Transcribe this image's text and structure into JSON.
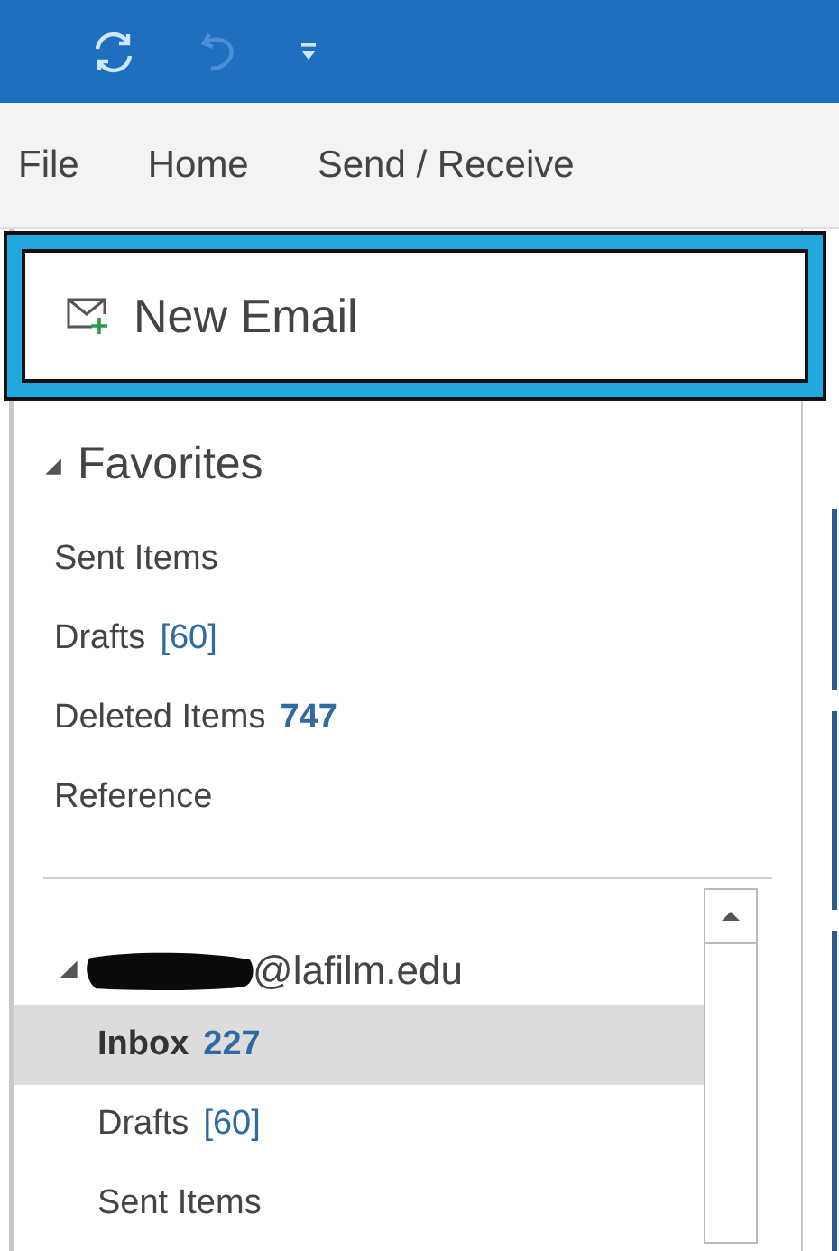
{
  "menu": [
    {
      "label": "File",
      "selected": false
    },
    {
      "label": "Home",
      "selected": false
    },
    {
      "label": "Send / Receive",
      "selected": false
    }
  ],
  "new_email": {
    "label": "New Email",
    "highlighted": true
  },
  "favorites": {
    "title": "Favorites",
    "expanded": true,
    "items": [
      {
        "name": "Sent Items",
        "selected": false
      },
      {
        "name": "Drafts",
        "count": "[60]",
        "kind": "draft",
        "selected": false
      },
      {
        "name": "Deleted Items",
        "count": "747",
        "kind": "unread",
        "selected": false
      },
      {
        "name": "Reference",
        "selected": false
      }
    ]
  },
  "account": {
    "name": "@lafilm.edu",
    "expanded": true,
    "redacted": true,
    "items": [
      {
        "name": "Inbox",
        "count": "227",
        "kind": "unread",
        "selected": true
      },
      {
        "name": "Drafts",
        "count": "[60]",
        "kind": "draft",
        "selected": false
      },
      {
        "name": "Sent Items",
        "selected": false
      }
    ]
  }
}
